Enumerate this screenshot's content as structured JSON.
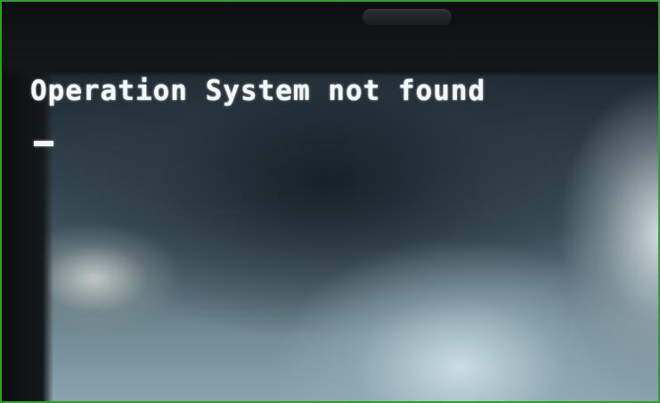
{
  "screen": {
    "message": "Operation System not found",
    "cursor": "_"
  },
  "colors": {
    "frame_border": "#2f9e2f",
    "text": "#f4f7f8",
    "bezel": "#0c0e10"
  }
}
